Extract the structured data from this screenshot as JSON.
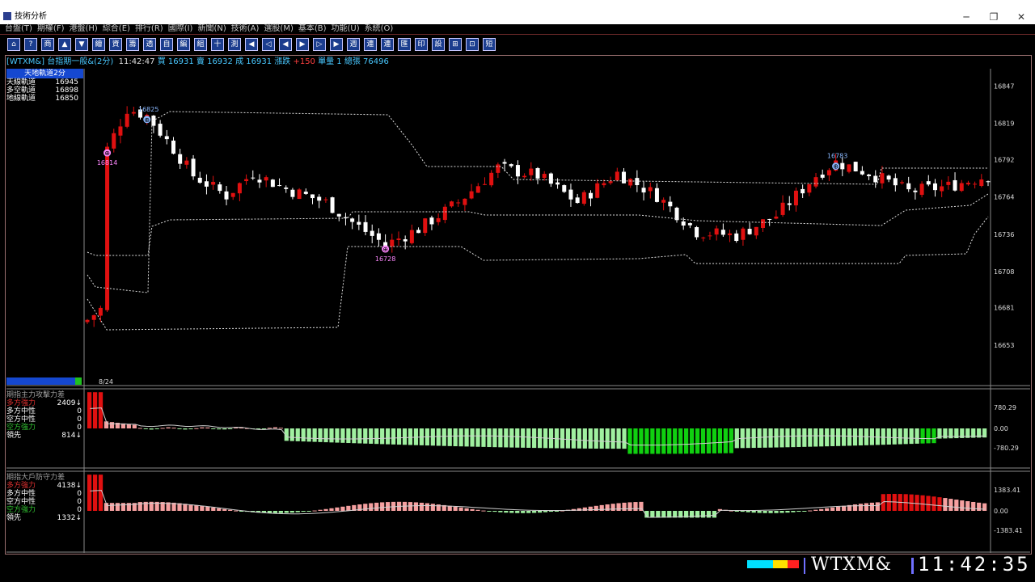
{
  "window": {
    "title": "技術分析",
    "min": "─",
    "restore": "❐",
    "close": "✕"
  },
  "menu": [
    "台盤(T)",
    "期權(F)",
    "港盤(H)",
    "綜合(E)",
    "排行(R)",
    "國際(I)",
    "新聞(N)",
    "技術(A)",
    "選股(M)",
    "基本(B)",
    "功能(U)",
    "系統(O)"
  ],
  "toolbar": [
    "⌂",
    "?",
    "商",
    "▲",
    "▼",
    "繪",
    "資",
    "籌",
    "透",
    "自",
    "編",
    "組",
    "十",
    "測",
    "◀",
    "◁",
    "◀",
    "▶",
    "▷",
    "▶",
    "週",
    "連",
    "連",
    "匯",
    "印",
    "設",
    "⊞",
    "⊡",
    "短"
  ],
  "info": {
    "symbol": "[WTXM&]",
    "name": "台指期一般&(2分)",
    "time": "11:42:47",
    "bid_label": "買",
    "bid": "16931",
    "ask_label": "賣",
    "ask": "16932",
    "last_label": "成",
    "last": "16931",
    "chg_label": "漲跌",
    "chg": "+150",
    "qty_label": "單量",
    "qty": "1",
    "vol_label": "總張",
    "vol": "76496"
  },
  "legend": {
    "title": "天地軌道2分",
    "rows": [
      {
        "label": "天線軌道",
        "value": "16945",
        "color": "#ffffff"
      },
      {
        "label": "多空軌道",
        "value": "16898",
        "color": "#ffffff"
      },
      {
        "label": "地線軌道",
        "value": "16850",
        "color": "#ffffff"
      }
    ]
  },
  "date_label": "8/24",
  "panel2": {
    "rows": [
      {
        "label": "期指主力攻擊力差",
        "value": "",
        "color": "#a0a0a0"
      },
      {
        "label": "多方強力",
        "value": "2409↓",
        "color": "#e03030"
      },
      {
        "label": "多方中性",
        "value": "0",
        "color": "#ffffff"
      },
      {
        "label": "空方中性",
        "value": "0",
        "color": "#ffffff"
      },
      {
        "label": "空方強力",
        "value": "0",
        "color": "#30c030"
      },
      {
        "label": "領先",
        "value": "814↓",
        "color": "#ffffff"
      }
    ],
    "axis": [
      "780.29",
      "0.00",
      "-780.29"
    ]
  },
  "panel3": {
    "rows": [
      {
        "label": "期指大戶防守力差",
        "value": "",
        "color": "#a0a0a0"
      },
      {
        "label": "多方強力",
        "value": "4138↓",
        "color": "#e03030"
      },
      {
        "label": "多方中性",
        "value": "0",
        "color": "#ffffff"
      },
      {
        "label": "空方中性",
        "value": "0",
        "color": "#ffffff"
      },
      {
        "label": "空方強力",
        "value": "0",
        "color": "#30c030"
      },
      {
        "label": "領先",
        "value": "1332↓",
        "color": "#ffffff"
      }
    ],
    "axis": [
      "1383.41",
      "0.00",
      "-1383.41"
    ]
  },
  "chart_data": {
    "type": "candlestick",
    "y_ticks": [
      16847,
      16819,
      16792,
      16764,
      16736,
      16708,
      16681,
      16653
    ],
    "ylim": [
      16630,
      16860
    ],
    "markers": [
      {
        "label": "16814",
        "price": 16797,
        "idx": 3,
        "kind": "low"
      },
      {
        "label": "16825",
        "price": 16822,
        "idx": 9,
        "kind": "high"
      },
      {
        "label": "16728",
        "price": 16725,
        "idx": 45,
        "kind": "low"
      },
      {
        "label": "16783",
        "price": 16787,
        "idx": 113,
        "kind": "high"
      }
    ]
  },
  "status": {
    "ticker": "WTXM&",
    "clock": "11:42:35"
  }
}
